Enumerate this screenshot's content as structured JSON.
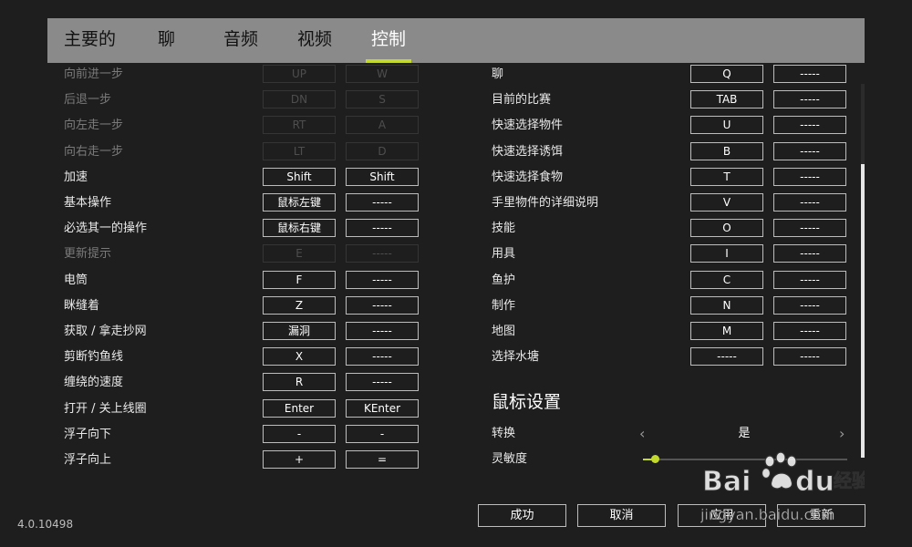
{
  "tabs": [
    {
      "label": "主要的",
      "active": false
    },
    {
      "label": "聊",
      "active": false
    },
    {
      "label": "音频",
      "active": false
    },
    {
      "label": "视频",
      "active": false
    },
    {
      "label": "控制",
      "active": true
    }
  ],
  "left_bindings": [
    {
      "label": "向前进一步",
      "key1": "UP",
      "key2": "W",
      "disabled": true
    },
    {
      "label": "后退一步",
      "key1": "DN",
      "key2": "S",
      "disabled": true
    },
    {
      "label": "向左走一步",
      "key1": "RT",
      "key2": "A",
      "disabled": true
    },
    {
      "label": "向右走一步",
      "key1": "LT",
      "key2": "D",
      "disabled": true
    },
    {
      "label": "加速",
      "key1": "Shift",
      "key2": "Shift",
      "disabled": false
    },
    {
      "label": "基本操作",
      "key1": "鼠标左键",
      "key2": "-----",
      "disabled": false
    },
    {
      "label": "必选其一的操作",
      "key1": "鼠标右键",
      "key2": "-----",
      "disabled": false
    },
    {
      "label": "更新提示",
      "key1": "E",
      "key2": "-----",
      "disabled": true
    },
    {
      "label": "电筒",
      "key1": "F",
      "key2": "-----",
      "disabled": false
    },
    {
      "label": "眯缝着",
      "key1": "Z",
      "key2": "-----",
      "disabled": false
    },
    {
      "label": "获取 / 拿走抄网",
      "key1": "漏洞",
      "key2": "-----",
      "disabled": false
    },
    {
      "label": "剪断钓鱼线",
      "key1": "X",
      "key2": "-----",
      "disabled": false
    },
    {
      "label": "缠绕的速度",
      "key1": "R",
      "key2": "-----",
      "disabled": false
    },
    {
      "label": "打开 / 关上线圈",
      "key1": "Enter",
      "key2": "KEnter",
      "disabled": false
    },
    {
      "label": "浮子向下",
      "key1": "-",
      "key2": "-",
      "disabled": false
    },
    {
      "label": "浮子向上",
      "key1": "+",
      "key2": "=",
      "disabled": false
    }
  ],
  "right_bindings": [
    {
      "label": "聊",
      "key1": "Q",
      "key2": "-----"
    },
    {
      "label": "目前的比赛",
      "key1": "TAB",
      "key2": "-----"
    },
    {
      "label": "快速选择物件",
      "key1": "U",
      "key2": "-----"
    },
    {
      "label": "快速选择诱饵",
      "key1": "B",
      "key2": "-----"
    },
    {
      "label": "快速选择食物",
      "key1": "T",
      "key2": "-----"
    },
    {
      "label": "手里物件的详细说明",
      "key1": "V",
      "key2": "-----"
    },
    {
      "label": "技能",
      "key1": "O",
      "key2": "-----"
    },
    {
      "label": "用具",
      "key1": "I",
      "key2": "-----"
    },
    {
      "label": "鱼护",
      "key1": "C",
      "key2": "-----"
    },
    {
      "label": "制作",
      "key1": "N",
      "key2": "-----"
    },
    {
      "label": "地图",
      "key1": "M",
      "key2": "-----"
    },
    {
      "label": "选择水塘",
      "key1": "-----",
      "key2": "-----"
    }
  ],
  "mouse_settings": {
    "title": "鼠标设置",
    "toggle_label": "转换",
    "toggle_value": "是",
    "sensitivity_label": "灵敏度",
    "sensitivity_fraction": 0.06
  },
  "buttons": {
    "success": "成功",
    "cancel": "取消",
    "apply": "应用",
    "reset": "重新"
  },
  "version": "4.0.10498",
  "colors": {
    "accent": "#c4d92e",
    "tabbar": "#8a8a8a",
    "background": "#1e1e1e"
  },
  "watermark_text": {
    "brand": "Bai  du",
    "brand_cn": "经验",
    "url": "jingyan.baidu.com"
  }
}
